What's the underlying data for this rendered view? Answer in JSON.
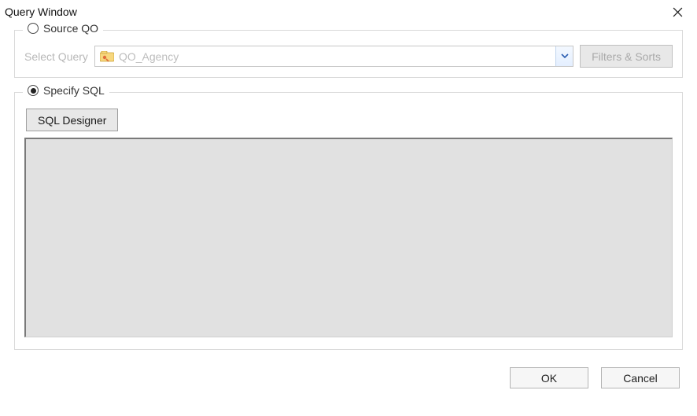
{
  "window": {
    "title": "Query Window"
  },
  "source_qo": {
    "legend": "Source QO",
    "select_label": "Select Query",
    "selected_value": "QO_Agency",
    "filters_button": "Filters & Sorts",
    "radio_checked": false
  },
  "specify_sql": {
    "legend": "Specify SQL",
    "designer_button": "SQL Designer",
    "sql_text": "",
    "radio_checked": true
  },
  "buttons": {
    "ok": "OK",
    "cancel": "Cancel"
  }
}
